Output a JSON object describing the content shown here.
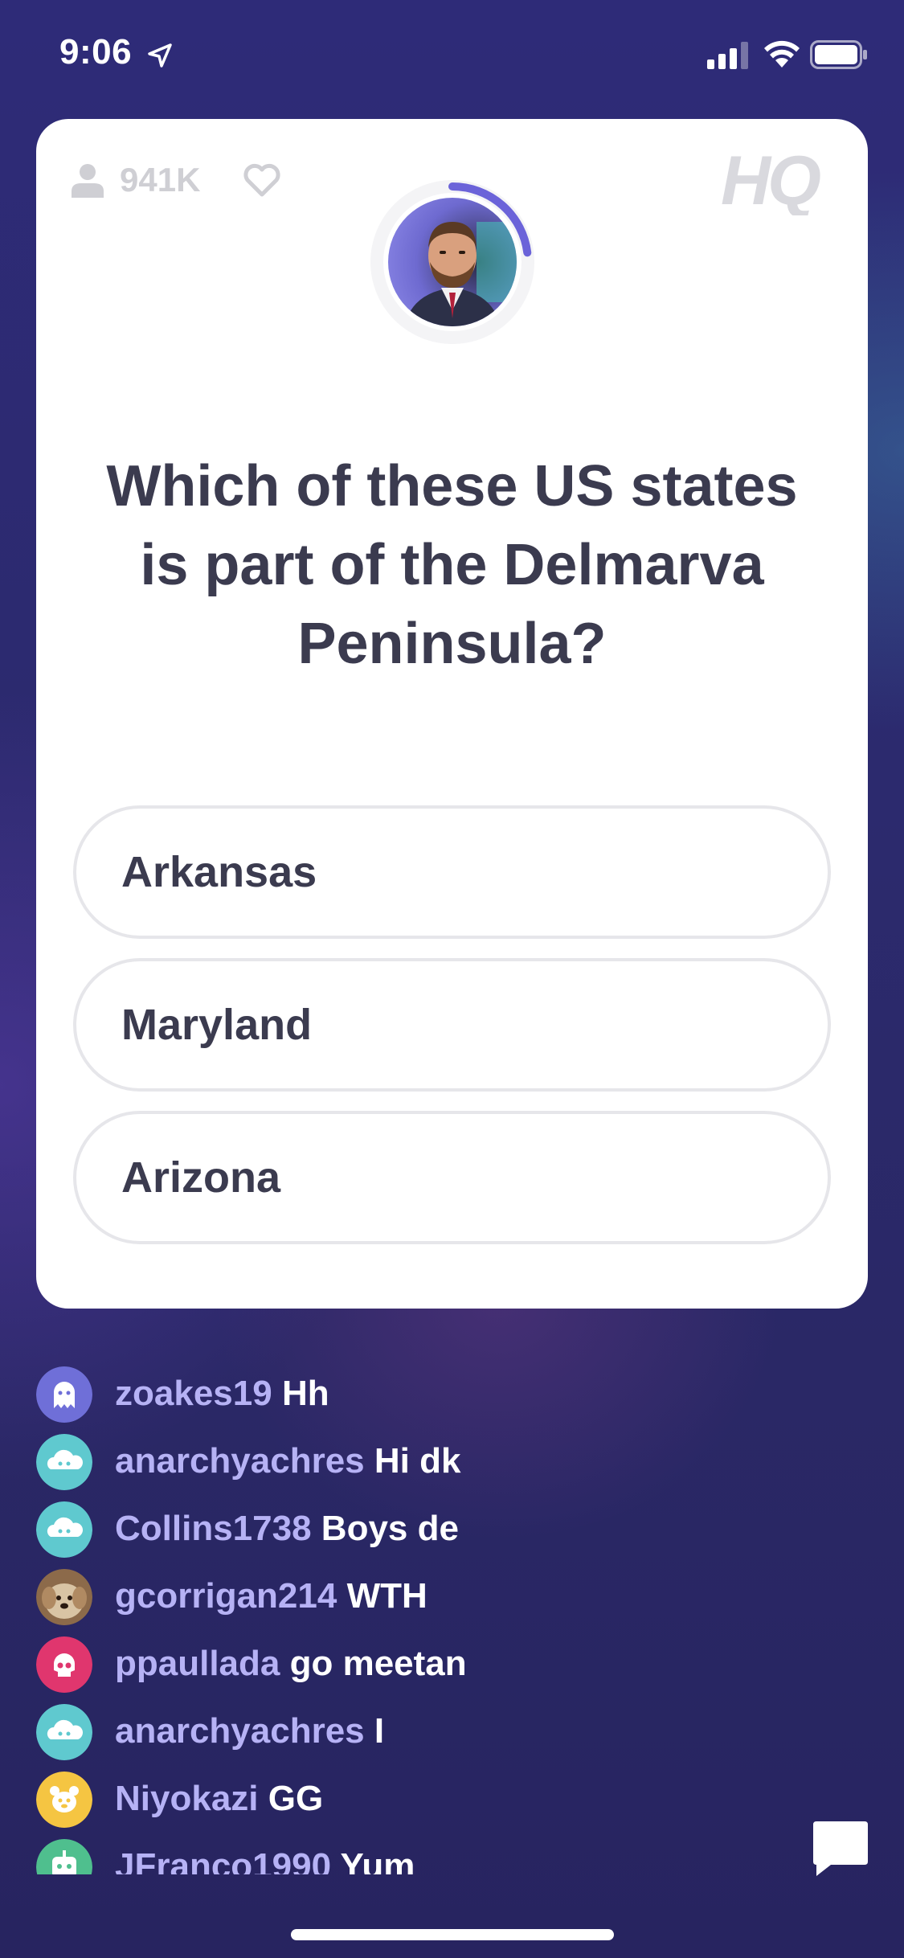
{
  "status_bar": {
    "time": "9:06"
  },
  "card": {
    "viewer_count": "941K",
    "logo_text": "HQ",
    "host_timer_progress": 0.23,
    "question": "Which of these US states is part of the Delmarva Peninsula?",
    "answers": [
      {
        "label": "Arkansas"
      },
      {
        "label": "Maryland"
      },
      {
        "label": "Arizona"
      }
    ]
  },
  "chat": {
    "messages": [
      {
        "user": "zoakes19",
        "text": "Hh",
        "avatar": "ghost-icon",
        "avatar_color": "#6f6fd8"
      },
      {
        "user": "anarchyachres",
        "text": "Hi dk",
        "avatar": "cloud-icon",
        "avatar_color": "#5fc9cf"
      },
      {
        "user": "Collins1738",
        "text": "Boys de",
        "avatar": "cloud-icon",
        "avatar_color": "#5fc9cf"
      },
      {
        "user": "gcorrigan214",
        "text": "WTH",
        "avatar": "dog-photo",
        "avatar_color": "#a07a55"
      },
      {
        "user": "ppaullada",
        "text": "go meetan",
        "avatar": "skull-icon",
        "avatar_color": "#e0366e"
      },
      {
        "user": "anarchyachres",
        "text": "I",
        "avatar": "cloud-icon",
        "avatar_color": "#5fc9cf"
      },
      {
        "user": "Niyokazi",
        "text": "GG",
        "avatar": "bear-icon",
        "avatar_color": "#f5c542"
      },
      {
        "user": "JFranco1990",
        "text": "Yum",
        "avatar": "robot-icon",
        "avatar_color": "#4fbf8e"
      }
    ]
  },
  "colors": {
    "accent": "#6b63d9",
    "chat_username": "#b6b2f5",
    "question_text": "#3b3b4f"
  }
}
